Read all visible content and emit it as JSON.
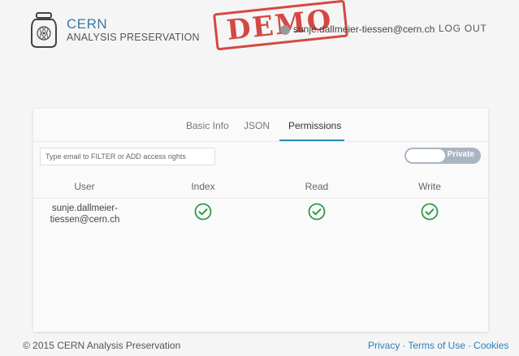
{
  "header": {
    "logo_line1": "CERN",
    "logo_line2": "ANALYSIS PRESERVATION",
    "stamp": "DEMO",
    "user_email": "sunje.dallmeier-tiessen@cern.ch",
    "logout": "LOG OUT"
  },
  "tabs": [
    {
      "label": "Basic Info",
      "active": false
    },
    {
      "label": "JSON",
      "active": false
    },
    {
      "label": "Permissions",
      "active": true
    }
  ],
  "filter": {
    "placeholder": "Type email to FILTER or ADD access rights",
    "value": ""
  },
  "privacy_toggle": {
    "label": "Private"
  },
  "table": {
    "columns": [
      "User",
      "Index",
      "Read",
      "Write"
    ],
    "rows": [
      {
        "user": "sunje.dallmeier-tiessen@cern.ch",
        "user_line1": "sunje.dallmeier-",
        "user_line2": "tiessen@cern.ch",
        "index": true,
        "read": true,
        "write": true
      }
    ]
  },
  "footer": {
    "copyright": "© 2015 CERN Analysis Preservation",
    "links": [
      "Privacy",
      "Terms of Use",
      "Cookies"
    ]
  },
  "colors": {
    "accent": "#2a8fbd",
    "brand": "#3b78a6",
    "check": "#2e9a47",
    "stamp": "#d0372f"
  }
}
